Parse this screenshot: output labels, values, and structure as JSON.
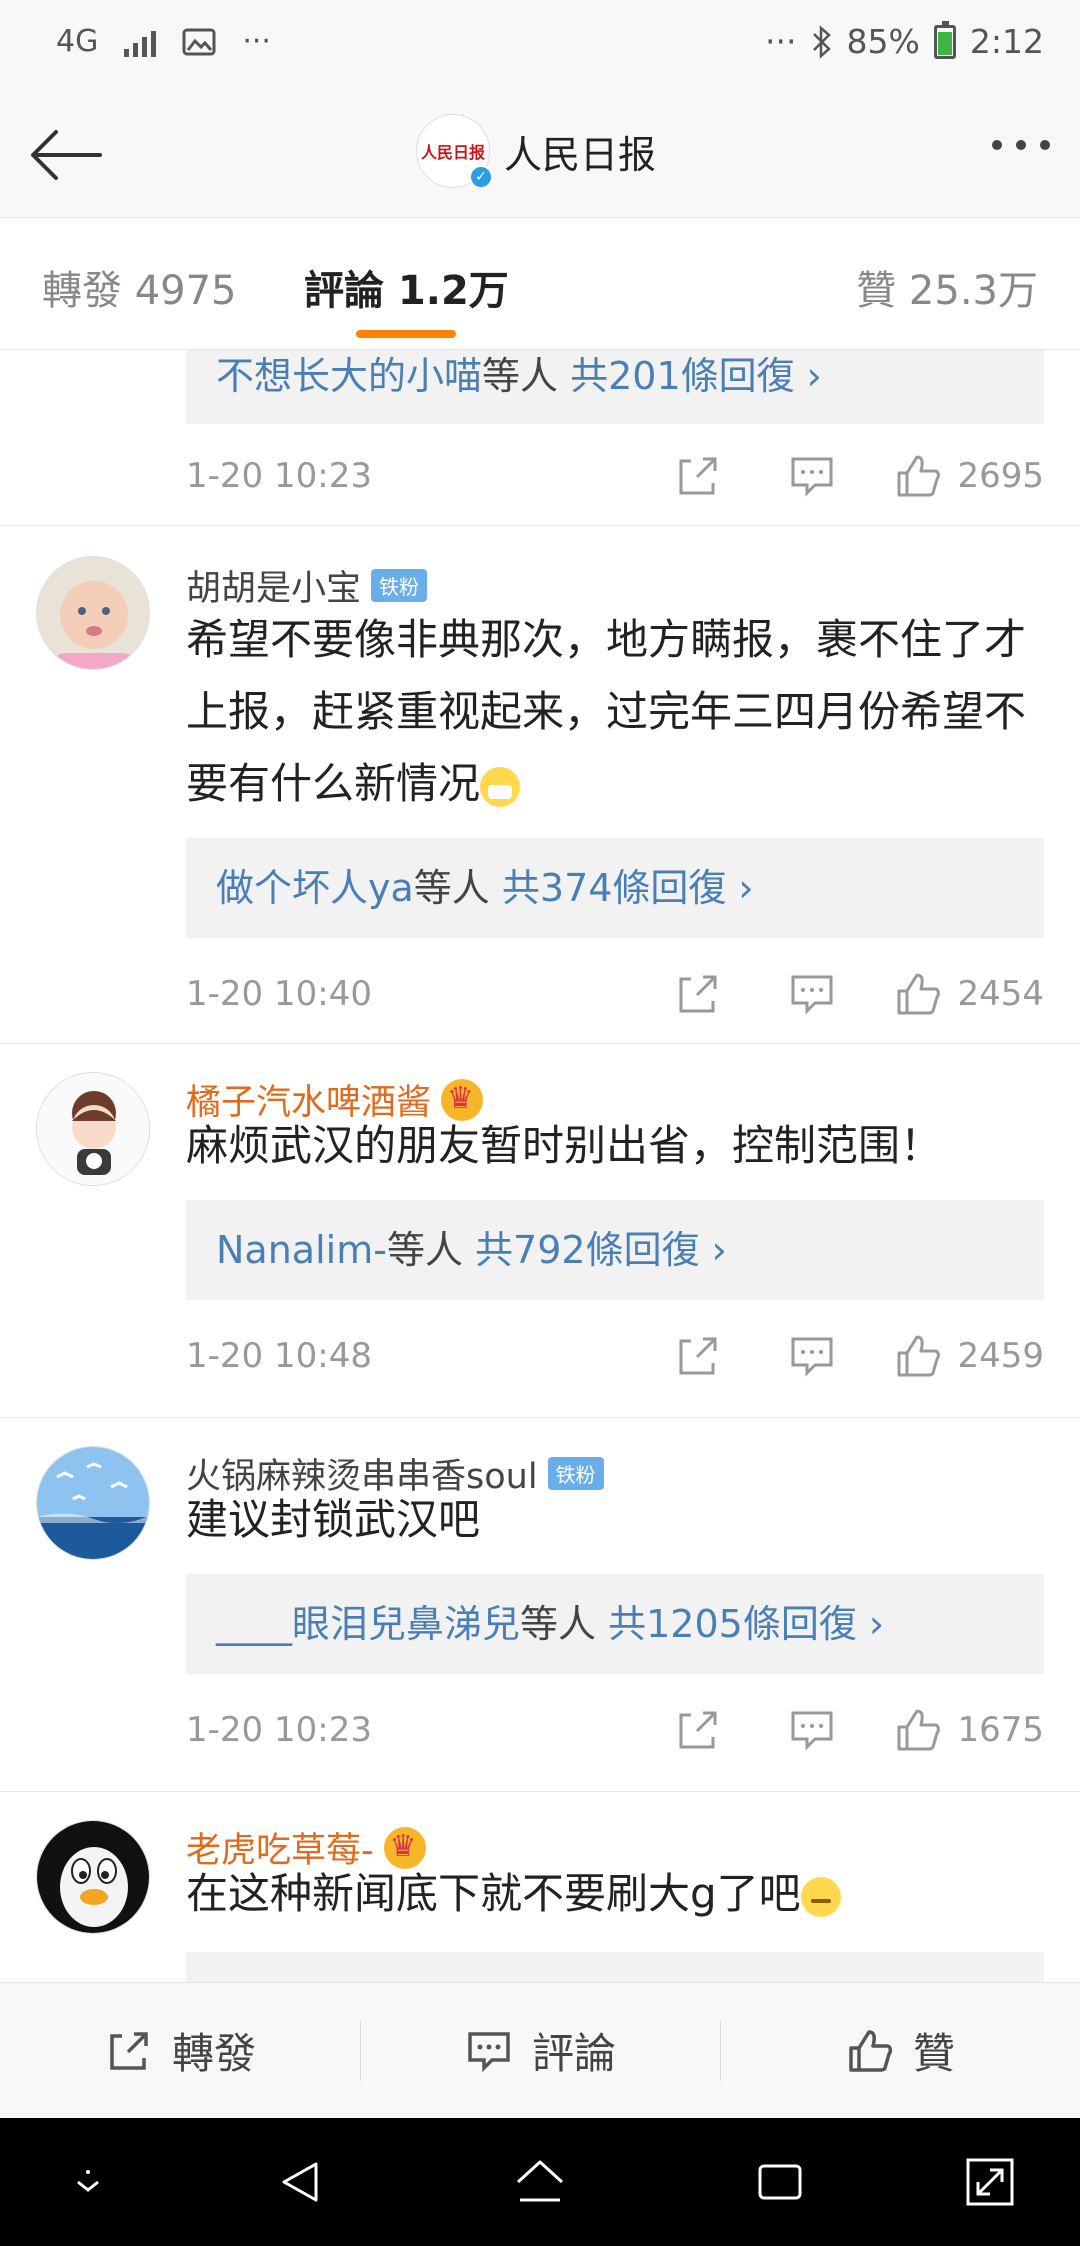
{
  "status_bar": {
    "network": "4G",
    "dots": "···",
    "battery_pct": "85%",
    "time": "2:12"
  },
  "header": {
    "account_name": "人民日报",
    "logo_text": "人民日报"
  },
  "tabs": [
    {
      "label": "轉發 4975"
    },
    {
      "label": "評論 1.2万"
    },
    {
      "label": "贊 25.3万"
    }
  ],
  "comments": [
    {
      "reply_users": "不想长大的小喵",
      "reply_suffix": "等人",
      "reply_count": "共201條回復",
      "time": "1-20 10:23",
      "likes": "2695"
    },
    {
      "user": "胡胡是小宝",
      "badge": "铁粉",
      "text": "希望不要像非典那次，地方瞒报，裹不住了才上报，赶紧重视起来，过完年三四月份希望不要有什么新情况",
      "reply_users": "做个坏人ya",
      "reply_suffix": "等人",
      "reply_count": "共374條回復",
      "time": "1-20 10:40",
      "likes": "2454"
    },
    {
      "user": "橘子汽水啤酒酱",
      "text": "麻烦武汉的朋友暂时别出省，控制范围！",
      "reply_users": "Nanalim-",
      "reply_suffix": "等人",
      "reply_count": "共792條回復",
      "time": "1-20 10:48",
      "likes": "2459"
    },
    {
      "user": "火锅麻辣烫串串香soul",
      "badge": "铁粉",
      "text": "建议封锁武汉吧",
      "reply_users": "____眼泪兒鼻涕兒",
      "reply_suffix": "等人",
      "reply_count": "共1205條回復",
      "time": "1-20 10:23",
      "likes": "1675"
    },
    {
      "user": "老虎吃草莓-",
      "text": "在这种新闻底下就不要刷大g了吧"
    }
  ],
  "bottom_bar": {
    "repost": "轉發",
    "comment": "評論",
    "like": "贊"
  },
  "colors": {
    "accent": "#ff8200",
    "link": "#4a7fb5",
    "vip_name": "#e26a1c",
    "badge": "#6aaee8"
  }
}
